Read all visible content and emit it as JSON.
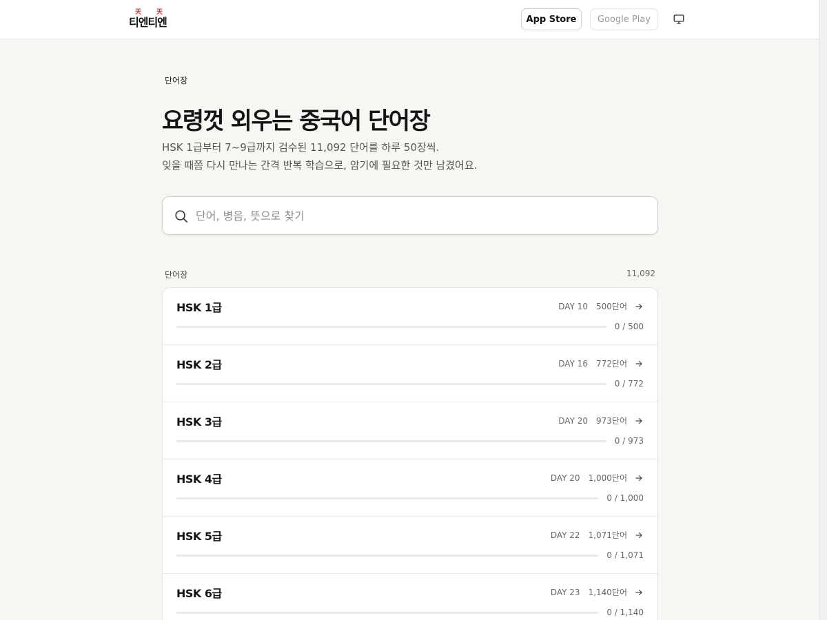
{
  "header": {
    "logo": {
      "word": "티엔티엔",
      "mark": "天"
    },
    "app_store": "App Store",
    "google_play": "Google Play",
    "desktop_icon": "desktop-icon"
  },
  "hero": {
    "breadcrumb": "단어장",
    "title": "요령껏 외우는 중국어 단어장",
    "subtitle_line1": "HSK 1급부터 7~9급까지 검수된 11,092 단어를 하루 50장씩.",
    "subtitle_line2": "잊을 때쯤 다시 만나는 간격 반복 학습으로, 암기에 필요한 것만 남겼어요."
  },
  "search": {
    "placeholder": "단어, 병음, 뜻으로 찾기",
    "value": ""
  },
  "list": {
    "label": "단어장",
    "total": "11,092",
    "items": [
      {
        "name": "HSK 1급",
        "day": "DAY 10",
        "count": "500단어",
        "progress": "0 / 500",
        "fraction": 0
      },
      {
        "name": "HSK 2급",
        "day": "DAY 16",
        "count": "772단어",
        "progress": "0 / 772",
        "fraction": 0
      },
      {
        "name": "HSK 3급",
        "day": "DAY 20",
        "count": "973단어",
        "progress": "0 / 973",
        "fraction": 0
      },
      {
        "name": "HSK 4급",
        "day": "DAY 20",
        "count": "1,000단어",
        "progress": "0 / 1,000",
        "fraction": 0
      },
      {
        "name": "HSK 5급",
        "day": "DAY 22",
        "count": "1,071단어",
        "progress": "0 / 1,071",
        "fraction": 0
      },
      {
        "name": "HSK 6급",
        "day": "DAY 23",
        "count": "1,140단어",
        "progress": "0 / 1,140",
        "fraction": 0
      }
    ]
  },
  "colors": {
    "accent_mark": "#d0312d",
    "background": "#f6f6f3",
    "text": "#1a1a1a"
  }
}
